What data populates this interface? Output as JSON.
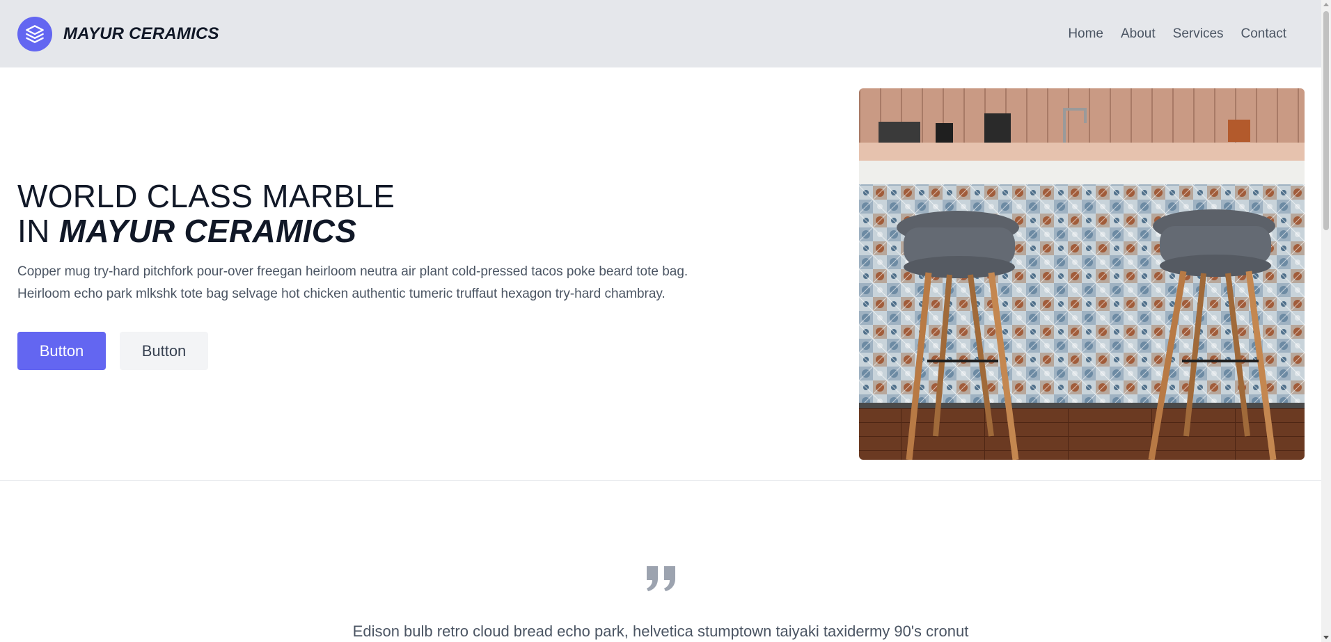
{
  "header": {
    "brand": "MAYUR CERAMICS",
    "logo_icon": "layers-icon",
    "nav": [
      {
        "label": "Home"
      },
      {
        "label": "About"
      },
      {
        "label": "Services"
      },
      {
        "label": "Contact"
      }
    ]
  },
  "hero": {
    "title_line1": "WORLD CLASS MARBLE",
    "title_prefix": "IN",
    "title_emphasis": "MAYUR CERAMICS",
    "description_line1": "Copper mug try-hard pitchfork pour-over freegan heirloom neutra air plant cold-pressed tacos poke beard tote bag.",
    "description_line2": "Heirloom echo park mlkshk tote bag selvage hot chicken authentic tumeric truffaut hexagon try-hard chambray.",
    "primary_button": "Button",
    "secondary_button": "Button"
  },
  "testimonial": {
    "quote_icon": "quote-icon",
    "text": "Edison bulb retro cloud bread echo park, helvetica stumptown taiyaki taxidermy 90's cronut"
  },
  "colors": {
    "accent": "#6366f1",
    "header_bg": "#e5e7eb",
    "text_dark": "#111827",
    "text_muted": "#4b5563"
  }
}
